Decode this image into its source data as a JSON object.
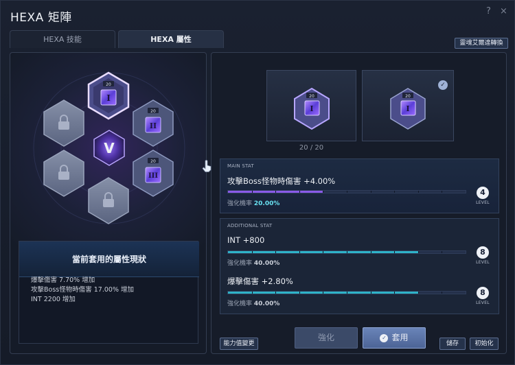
{
  "window": {
    "title": "HEXA 矩陣",
    "help": "?",
    "close": "×"
  },
  "tabs": [
    {
      "label": "HEXA 技能"
    },
    {
      "label": "HEXA 屬性"
    }
  ],
  "convert_button": "靈魂艾爾達轉換",
  "hex_grid": {
    "center_logo": "V",
    "active_level": "20",
    "slots": [
      {
        "level": "20",
        "numeral": "I",
        "state": "selected"
      },
      {
        "level": "20",
        "numeral": "II",
        "state": "unlocked"
      },
      {
        "level": "20",
        "numeral": "III",
        "state": "unlocked"
      },
      {
        "state": "locked"
      },
      {
        "state": "locked"
      },
      {
        "state": "locked"
      }
    ]
  },
  "status_box": {
    "title": "當前套用的屬性現狀",
    "lines": [
      "爆擊傷害 7.70% 增加",
      "攻擊Boss怪物時傷害 17.00% 增加",
      "INT 2200 增加"
    ]
  },
  "cards": {
    "primary_count": "20",
    "primary_max": "20",
    "count_sep": "/",
    "check": "✓",
    "primary_level": "20",
    "secondary_level": "20"
  },
  "main_stat": {
    "section": "MAIN STAT",
    "text": "攻擊Boss怪物時傷害 +4.00%",
    "rate_label": "強化機率",
    "rate": "20.00%",
    "level": "4",
    "level_label": "LEVEL",
    "progress": 0.4
  },
  "additional_stat": {
    "section": "ADDITIONAL STAT",
    "items": [
      {
        "text": "INT +800",
        "rate_label": "強化機率",
        "rate": "40.00%",
        "level": "8",
        "level_label": "LEVEL",
        "progress": 0.8
      },
      {
        "text": "爆擊傷害 +2.80%",
        "rate_label": "強化機率",
        "rate": "40.00%",
        "level": "8",
        "level_label": "LEVEL",
        "progress": 0.8
      }
    ]
  },
  "buttons": {
    "change": "能力值變更",
    "enhance": "強化",
    "apply": "套用",
    "apply_icon": "✓",
    "save": "儲存",
    "reset": "初始化"
  },
  "colors": {
    "main_bar": "#8a5be8",
    "add_bar": "#2fb3c8",
    "rate_highlight": "#68e0f0"
  }
}
